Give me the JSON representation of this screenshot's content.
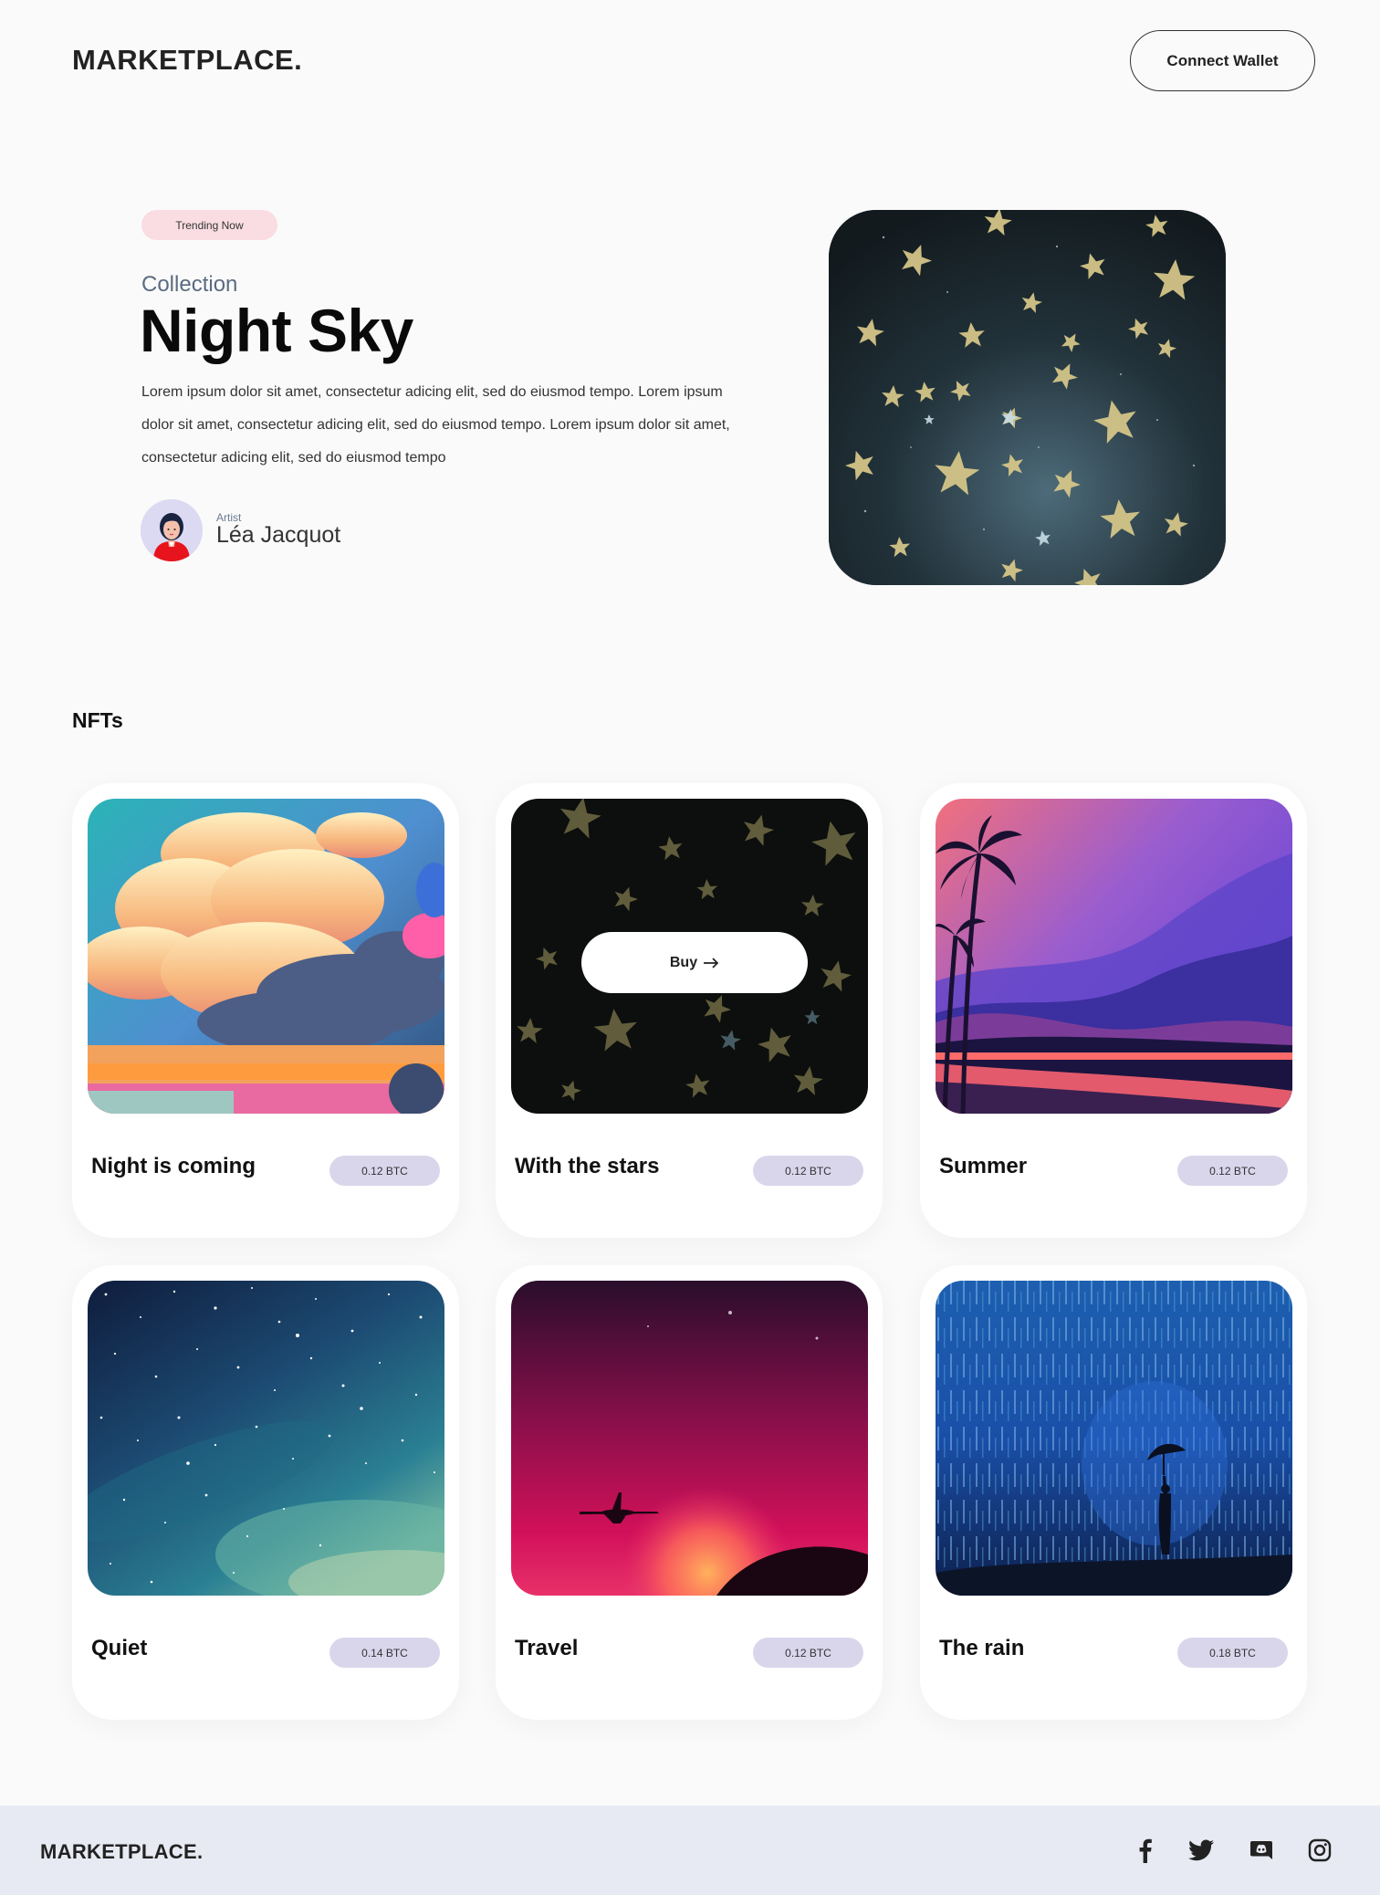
{
  "header": {
    "logo": "MARKETPLACE.",
    "connect_label": "Connect Wallet"
  },
  "hero": {
    "badge": "Trending Now",
    "subtitle": "Collection",
    "title": "Night Sky",
    "description": "Lorem ipsum dolor sit amet, consectetur adicing elit, sed do eiusmod tempo. Lorem ipsum dolor sit amet, consectetur adicing elit, sed do eiusmod tempo. Lorem ipsum dolor sit amet, consectetur adicing elit, sed do eiusmod tempo",
    "artist_label": "Artist",
    "artist_name": "Léa Jacquot"
  },
  "nfts": {
    "section_title": "NFTs",
    "buy_label": "Buy",
    "items": [
      {
        "name": "Night is coming",
        "price": "0.12 BTC"
      },
      {
        "name": "With the stars",
        "price": "0.12 BTC"
      },
      {
        "name": "Summer",
        "price": "0.12 BTC"
      },
      {
        "name": "Quiet",
        "price": "0.14 BTC"
      },
      {
        "name": "Travel",
        "price": "0.12 BTC"
      },
      {
        "name": "The rain",
        "price": "0.18 BTC"
      }
    ]
  },
  "footer": {
    "logo": "MARKETPLACE.",
    "social_icons": [
      "facebook-icon",
      "twitter-icon",
      "discord-icon",
      "instagram-icon"
    ]
  },
  "colors": {
    "background": "#fafafa",
    "trending_badge": "#f9dde3",
    "price_badge": "#d9d6ec",
    "footer": "#e8eaf3"
  }
}
